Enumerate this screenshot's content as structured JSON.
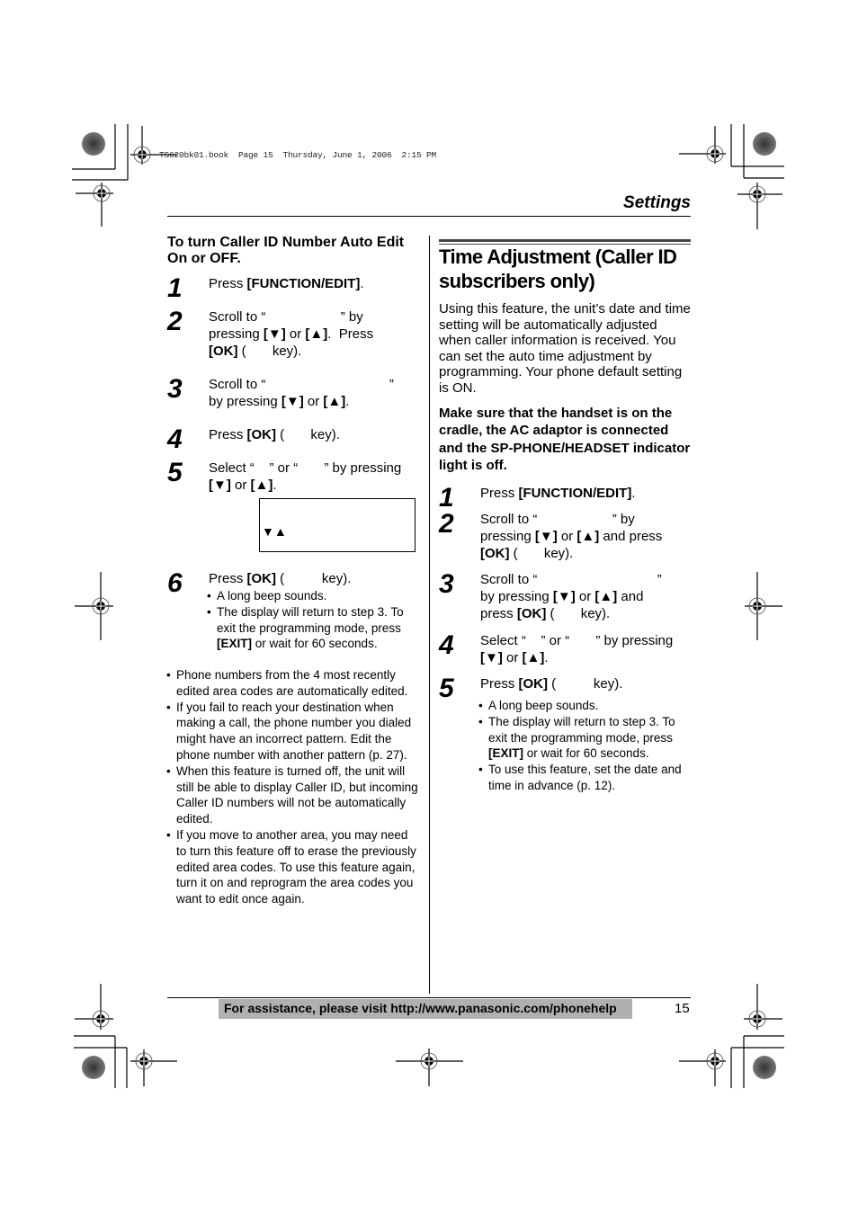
{
  "book_header": "TS620bk01.book  Page 15  Thursday, June 1, 2006  2:15 PM",
  "section_title": "Settings",
  "left_column": {
    "subheading": "To turn Caller ID Number Auto Edit On or OFF.",
    "steps": [
      {
        "number": "1",
        "parts": [
          "Press ",
          "[FUNCTION/EDIT]",
          "."
        ]
      },
      {
        "number": "2",
        "line1": "Scroll to “                    ” by",
        "line2_a": "pressing ",
        "line2_k1": "[▼]",
        "line2_b": " or ",
        "line2_k2": "[▲]",
        "line2_c": ".  Press",
        "line3_k": "[OK]",
        "line3_b": " (       key)."
      },
      {
        "number": "3",
        "line1": "Scroll to “                                 ”",
        "line2_a": "by pressing ",
        "line2_k1": "[▼]",
        "line2_b": " or ",
        "line2_k2": "[▲]",
        "line2_c": "."
      },
      {
        "number": "4",
        "a": "Press ",
        "k": "[OK]",
        "b": " (       key)."
      },
      {
        "number": "5",
        "line1": "Select “    ” or “       ” by pressing",
        "line2_k1": "[▼]",
        "line2_b": " or ",
        "line2_k2": "[▲]",
        "line2_c": "."
      },
      {
        "number": "6",
        "a": "Press ",
        "k": "[OK]",
        "b": " (          key)."
      }
    ],
    "display_arrows": "▼▲",
    "step6_bullets": {
      "b1": "A long beep sounds.",
      "b2": "The display will return to step 3. To exit the programming mode, press",
      "b2_key": "[EXIT]",
      "b2_end": " or wait for 60 seconds."
    },
    "notes": [
      "Phone numbers from the 4 most recently edited area codes are automatically edited.",
      "If you fail to reach your destination when making a call, the phone number you dialed might have an incorrect pattern. Edit the phone number with another pattern (p. 27).",
      "When this feature is turned off, the unit will still be able to display Caller ID, but incoming Caller ID numbers will not be automatically edited.",
      "If you move to another area, you may need to turn this feature off to erase the previously edited area codes. To use this feature again, turn it on and reprogram the area codes you want to edit once again."
    ]
  },
  "right_column": {
    "heading": "Time Adjustment (Caller ID subscribers only)",
    "intro": "Using this feature, the unit’s date and time setting will be automatically adjusted when caller information is received. You can set the auto time adjustment by programming. Your phone default setting is ON.",
    "warning": "Make sure that the handset is on the cradle, the AC adaptor is connected and the SP-PHONE/HEADSET indicator light is off.",
    "steps": [
      {
        "number": "1",
        "a": "Press ",
        "k": "[FUNCTION/EDIT]",
        "b": "."
      },
      {
        "number": "2",
        "line1": "Scroll to “                    ” by",
        "line2_a": "pressing ",
        "line2_k1": "[▼]",
        "line2_b": " or ",
        "line2_k2": "[▲]",
        "line2_c": " and press",
        "line3_k": "[OK]",
        "line3_b": " (       key)."
      },
      {
        "number": "3",
        "line1": "Scroll to “                                ”",
        "line2_a": "by pressing ",
        "line2_k1": "[▼]",
        "line2_b": " or ",
        "line2_k2": "[▲]",
        "line2_c": " and",
        "line3_a": "press ",
        "line3_k": "[OK]",
        "line3_b": " (       key)."
      },
      {
        "number": "4",
        "line1": "Select “    ” or “       ” by pressing",
        "line2_k1": "[▼]",
        "line2_b": " or ",
        "line2_k2": "[▲]",
        "line2_c": "."
      },
      {
        "number": "5",
        "a": "Press ",
        "k": "[OK]",
        "b": " (          key)."
      }
    ],
    "step5_bullets": {
      "b1": "A long beep sounds.",
      "b2": "The display will return to step 3. To exit the programming mode, press",
      "b2_key": "[EXIT]",
      "b2_end": " or wait for 60 seconds.",
      "b3": "To use this feature, set the date and time in advance (p. 12)."
    }
  },
  "footer": {
    "assistance": "For assistance, please visit http://www.panasonic.com/phonehelp",
    "page_number": "15"
  }
}
